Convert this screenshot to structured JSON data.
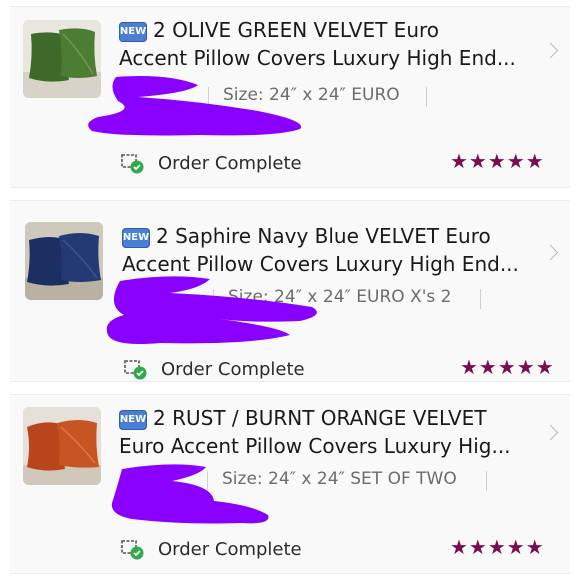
{
  "orders": [
    {
      "badge": "NEW",
      "title_line1": "2 OLIVE GREEN VELVET Euro",
      "title_line2": "Accent Pillow Covers Luxury High End...",
      "size": "Size: 24″ x 24″ EURO",
      "status": "Order Complete",
      "stars": "★★★★★",
      "rating": 5,
      "pillow_color": "#3f6b2a"
    },
    {
      "badge": "NEW",
      "title_line1": "2 Saphire Navy Blue VELVET Euro",
      "title_line2": "Accent Pillow Covers Luxury High End...",
      "size": "Size: 24″ x 24″ EURO X's 2",
      "status": "Order Complete",
      "stars": "★★★★★",
      "rating": 5,
      "pillow_color": "#1c2f63"
    },
    {
      "badge": "NEW",
      "title_line1": "2 RUST / BURNT ORANGE VELVET",
      "title_line2": "Euro Accent Pillow Covers Luxury Hig...",
      "size": "Size: 24″ x 24″ SET OF TWO",
      "status": "Order Complete",
      "stars": "★★★★★",
      "rating": 5,
      "pillow_color": "#b8451c"
    }
  ],
  "colors": {
    "star": "#7a0d4e",
    "redaction": "#8a00ff",
    "check": "#2eaa4a",
    "badge": "#4a7fd4"
  },
  "icons": {
    "status": "package-check-icon",
    "chevron": "chevron-right-icon"
  }
}
